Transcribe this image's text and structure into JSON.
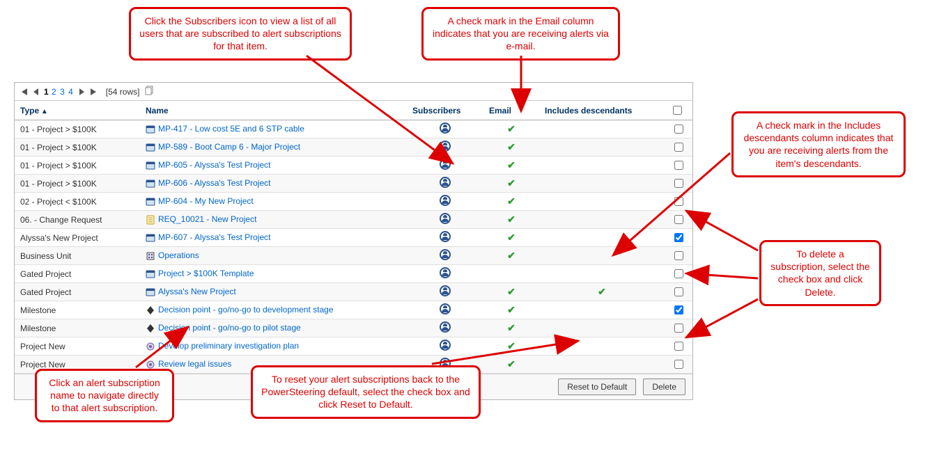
{
  "pager": {
    "pages": [
      "1",
      "2",
      "3",
      "4"
    ],
    "row_count": "[54 rows]"
  },
  "columns": {
    "type": "Type",
    "name": "Name",
    "subscribers": "Subscribers",
    "email": "Email",
    "descendants": "Includes descendants"
  },
  "rows": [
    {
      "type": "01 - Project > $100K",
      "name": "MP-417 - Low cost 5E and 6 STP cable",
      "icon": "project",
      "subscribers": true,
      "email": true,
      "descendants": false,
      "checked": false
    },
    {
      "type": "01 - Project > $100K",
      "name": "MP-589 - Boot Camp 6 - Major Project",
      "icon": "project",
      "subscribers": true,
      "email": true,
      "descendants": false,
      "checked": false
    },
    {
      "type": "01 - Project > $100K",
      "name": "MP-605 - Alyssa's Test Project",
      "icon": "project",
      "subscribers": true,
      "email": true,
      "descendants": false,
      "checked": false
    },
    {
      "type": "01 - Project > $100K",
      "name": "MP-606 - Alyssa's Test Project",
      "icon": "project",
      "subscribers": true,
      "email": true,
      "descendants": false,
      "checked": false
    },
    {
      "type": "02 - Project < $100K",
      "name": "MP-604 - My New Project",
      "icon": "project",
      "subscribers": true,
      "email": true,
      "descendants": false,
      "checked": false
    },
    {
      "type": "06. - Change Request",
      "name": "REQ_10021 - New Project",
      "icon": "request",
      "subscribers": true,
      "email": true,
      "descendants": false,
      "checked": false
    },
    {
      "type": "Alyssa's New Project",
      "name": "MP-607 - Alyssa's Test Project",
      "icon": "project",
      "subscribers": true,
      "email": true,
      "descendants": false,
      "checked": true
    },
    {
      "type": "Business Unit",
      "name": "Operations",
      "icon": "unit",
      "subscribers": true,
      "email": true,
      "descendants": false,
      "checked": false
    },
    {
      "type": "Gated Project",
      "name": "Project > $100K Template",
      "icon": "project",
      "subscribers": true,
      "email": false,
      "descendants": false,
      "checked": false
    },
    {
      "type": "Gated Project",
      "name": "Alyssa's New Project",
      "icon": "project",
      "subscribers": true,
      "email": true,
      "descendants": true,
      "checked": false
    },
    {
      "type": "Milestone",
      "name": "Decision point - go/no-go to development stage",
      "icon": "milestone",
      "subscribers": true,
      "email": true,
      "descendants": false,
      "checked": true
    },
    {
      "type": "Milestone",
      "name": "Decision point - go/no-go to pilot stage",
      "icon": "milestone",
      "subscribers": true,
      "email": true,
      "descendants": false,
      "checked": false
    },
    {
      "type": "Project New",
      "name": "Develop preliminary investigation plan",
      "icon": "gear",
      "subscribers": true,
      "email": true,
      "descendants": false,
      "checked": false
    },
    {
      "type": "Project New",
      "name": "Review legal issues",
      "icon": "gear",
      "subscribers": true,
      "email": true,
      "descendants": false,
      "checked": false
    }
  ],
  "buttons": {
    "reset": "Reset to Default",
    "delete": "Delete"
  },
  "callouts": {
    "subscribers": "Click the Subscribers icon to view a list of all users that are subscribed to alert subscriptions for that item.",
    "email": "A check mark in the Email column indicates that you are receiving alerts via e-mail.",
    "descendants": "A check mark in the Includes descendants column indicates that you are receiving alerts from the item's descendants.",
    "delete": "To delete a subscription, select the check box and click Delete.",
    "name": "Click an alert subscription name to navigate directly to that alert subscription.",
    "reset": "To reset your alert subscriptions back to the PowerSteering default, select the check box and click Reset to Default."
  }
}
